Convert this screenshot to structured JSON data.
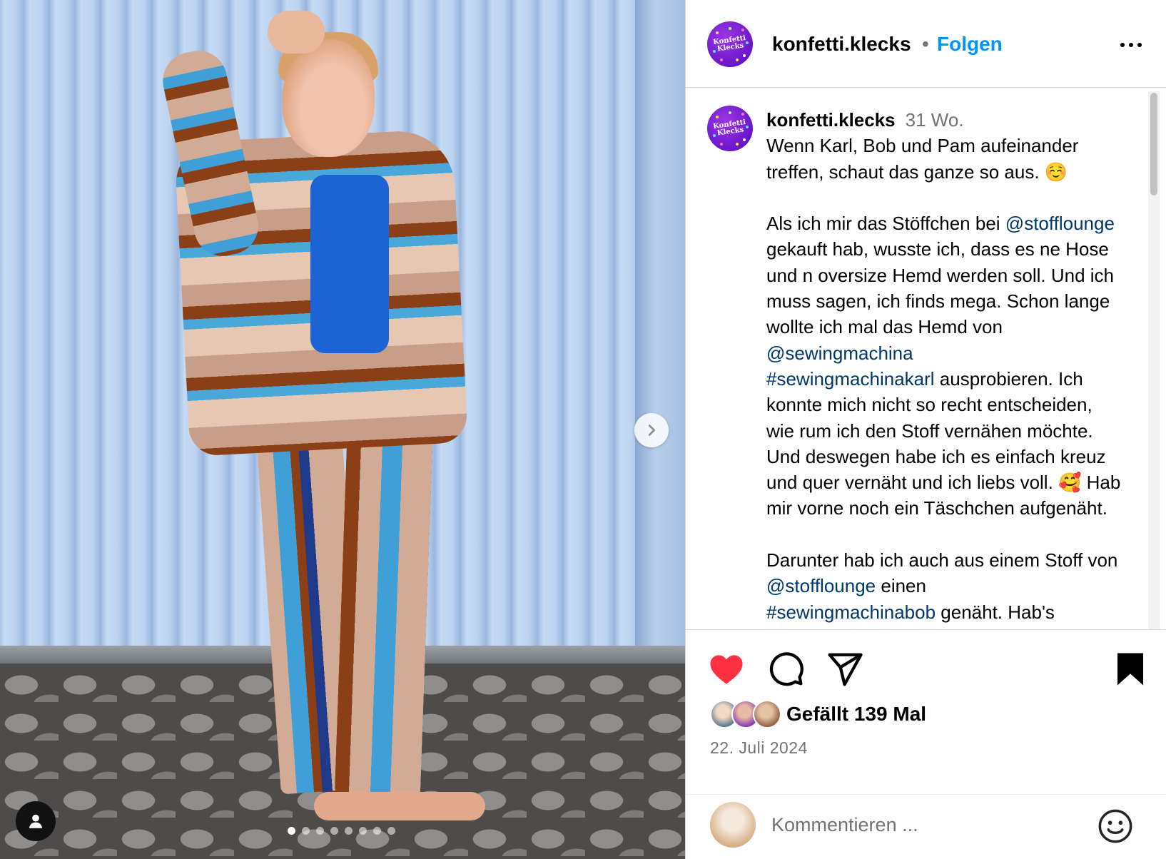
{
  "post": {
    "username": "konfetti.klecks",
    "avatar_text": "Konfetti Klecks",
    "follow_label": "Folgen",
    "separator": "•"
  },
  "caption": {
    "username": "konfetti.klecks",
    "time": "31 Wo.",
    "segments": [
      {
        "type": "text",
        "value": "Wenn Karl, Bob und Pam aufeinander treffen, schaut das ganze so aus. ☺️\n\nAls ich mir das Stöffchen bei "
      },
      {
        "type": "link",
        "value": "@stofflounge"
      },
      {
        "type": "text",
        "value": " gekauft hab, wusste ich, dass es ne Hose und n oversize Hemd werden soll. Und ich muss sagen, ich finds mega. Schon lange wollte ich mal das Hemd von "
      },
      {
        "type": "link",
        "value": "@sewingmachina"
      },
      {
        "type": "text",
        "value": "\n"
      },
      {
        "type": "link",
        "value": "#sewingmachinakarl"
      },
      {
        "type": "text",
        "value": " ausprobieren. Ich konnte mich nicht so recht entscheiden, wie rum ich den Stoff vernähen möchte. Und deswegen habe ich es einfach kreuz und quer vernäht und ich liebs voll. 🥰 Hab mir vorne noch ein Täschchen aufgenäht.\n\nDarunter hab ich auch aus einem Stoff von "
      },
      {
        "type": "link",
        "value": "@stofflounge"
      },
      {
        "type": "text",
        "value": " einen\n"
      },
      {
        "type": "link",
        "value": "#sewingmachinabob"
      },
      {
        "type": "text",
        "value": " genäht. Hab's"
      }
    ]
  },
  "actions": {
    "likes_text": "Gefällt 139 Mal",
    "date": "22. Juli 2024",
    "comment_placeholder": "Kommentieren ...",
    "liked": true
  },
  "carousel": {
    "count": 8,
    "active_index": 0
  },
  "colors": {
    "accent": "#0095f6",
    "link": "#00376b",
    "like": "#ff3040",
    "muted": "#737373"
  },
  "icons": [
    "chevron-right-icon",
    "tag-user-icon",
    "more-icon",
    "heart-icon",
    "comment-icon",
    "share-icon",
    "bookmark-icon",
    "emoji-icon"
  ]
}
